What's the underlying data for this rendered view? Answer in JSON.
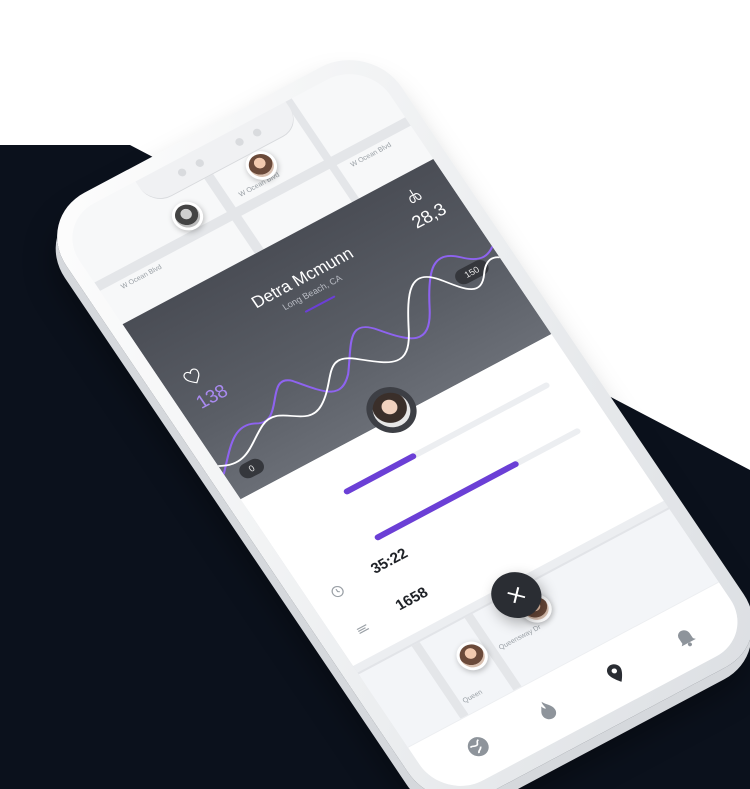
{
  "map_top": {
    "roads": [
      "W Ocean Blvd",
      "W Ocean Blvd",
      "W Ocean Blvd"
    ]
  },
  "profile": {
    "name": "Detra Mcmunn",
    "location": "Long Beach, CA"
  },
  "vitals": {
    "heart_rate": "138",
    "lung_value": "28,3",
    "range_max": "150",
    "range_min": "0"
  },
  "metrics": {
    "time": "35:22",
    "time_progress": 0.35,
    "count": "1658",
    "count_progress": 0.7
  },
  "map_bottom": {
    "roads": [
      "Queensway Dr",
      "Queen"
    ]
  },
  "colors": {
    "accent": "#6b3fd6",
    "dark_card": "#4a4d55",
    "backdrop": "#0b111c"
  },
  "icons": {
    "heart": "heart-icon",
    "lungs": "lungs-icon",
    "clock": "clock-icon",
    "distance": "distance-icon",
    "close": "close-icon",
    "globe": "globe-icon",
    "flame": "flame-icon",
    "location": "location-pin-icon",
    "bell": "bell-icon"
  }
}
